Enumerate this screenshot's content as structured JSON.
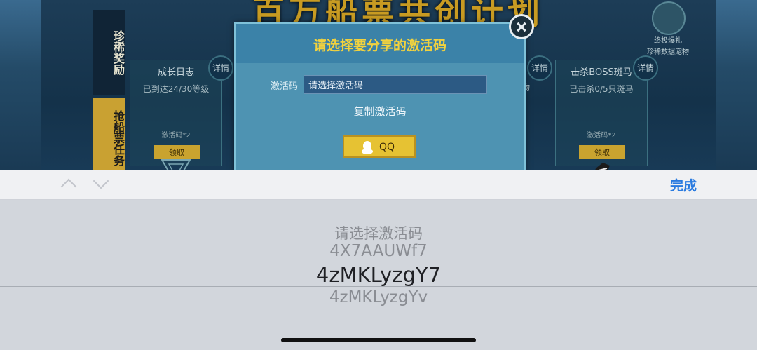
{
  "game": {
    "banner": "百万船票共创计划",
    "side_tabs": {
      "rare_rewards": "珍稀奖励",
      "ticket_tasks": "抢船票任务"
    },
    "tasks": [
      {
        "title": "成长日志",
        "progress": "已到达24/30等级",
        "reward": "激活码*2",
        "claim": "领取",
        "detail": "详情"
      },
      {
        "title": "击杀BOSS斑马",
        "progress": "已击杀0/5只斑马",
        "reward": "激活码*2",
        "claim": "领取",
        "detail": "详情"
      }
    ],
    "middle_detail": "详情",
    "middle_partial": "物",
    "ultimate_reward": {
      "line1": "终极爆礼",
      "line2": "珍稀数据宠物"
    }
  },
  "dialog": {
    "title": "请选择要分享的激活码",
    "code_label": "激活码",
    "code_value": "请选择激活码",
    "copy_link": "复制激活码",
    "qq_button": "QQ"
  },
  "keyboard_toolbar": {
    "done": "完成"
  },
  "picker": {
    "options": [
      "请选择激活码",
      "4X7AAUWf7",
      "4zMKLyzgY7",
      "4zMKLyzgYv"
    ],
    "selected": "4zMKLyzgY7"
  },
  "colors": {
    "accent_blue": "#2a7be0",
    "dialog_bg": "#4e93b2",
    "title_yellow": "#f2d23e",
    "button_gold": "#e6c233"
  }
}
